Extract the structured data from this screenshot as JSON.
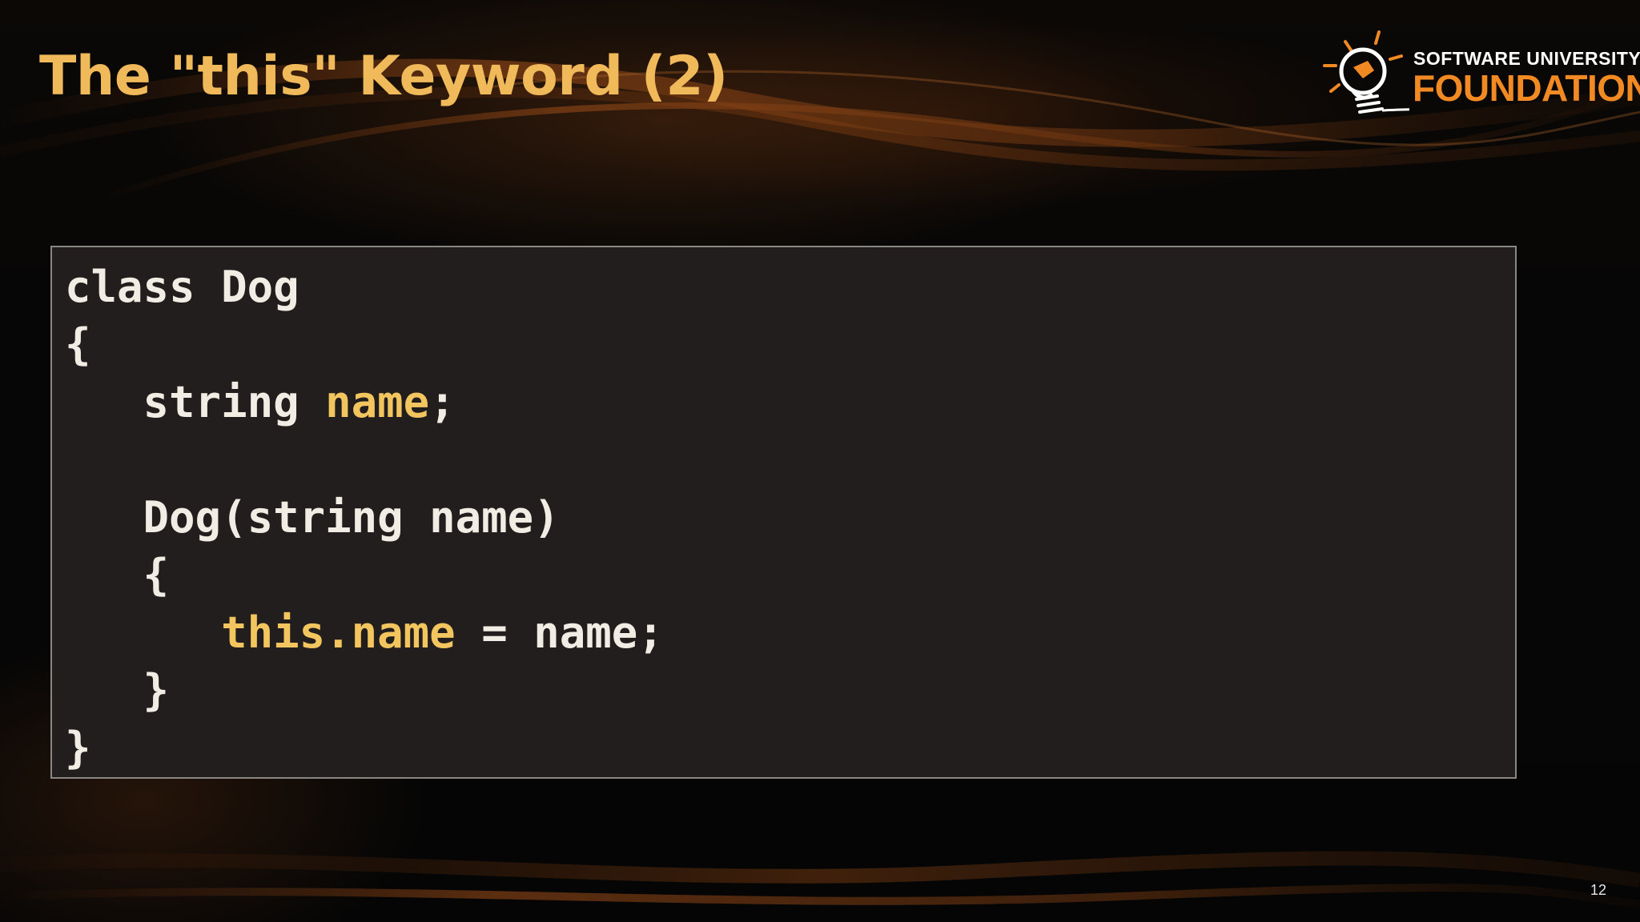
{
  "slide": {
    "title": "The \"this\" Keyword (2)",
    "page_number": "12"
  },
  "logo": {
    "line1": "SOFTWARE UNIVERSITY",
    "line2": "FOUNDATION"
  },
  "code": {
    "lines": [
      [
        {
          "text": "class Dog",
          "style": "plain"
        }
      ],
      [
        {
          "text": "{",
          "style": "plain"
        }
      ],
      [
        {
          "text": "   string ",
          "style": "plain"
        },
        {
          "text": "name",
          "style": "accent"
        },
        {
          "text": ";",
          "style": "plain"
        }
      ],
      [],
      [
        {
          "text": "   Dog(string name)",
          "style": "plain"
        }
      ],
      [
        {
          "text": "   {",
          "style": "plain"
        }
      ],
      [
        {
          "text": "      ",
          "style": "plain"
        },
        {
          "text": "this.name",
          "style": "accent"
        },
        {
          "text": " = name;",
          "style": "plain"
        }
      ],
      [
        {
          "text": "   }",
          "style": "plain"
        }
      ],
      [
        {
          "text": "}",
          "style": "plain"
        }
      ]
    ]
  },
  "colors": {
    "title": "#f0b95a",
    "accent_code": "#f2c55f",
    "brand_orange": "#f28a23",
    "code_background": "#221f1e"
  }
}
